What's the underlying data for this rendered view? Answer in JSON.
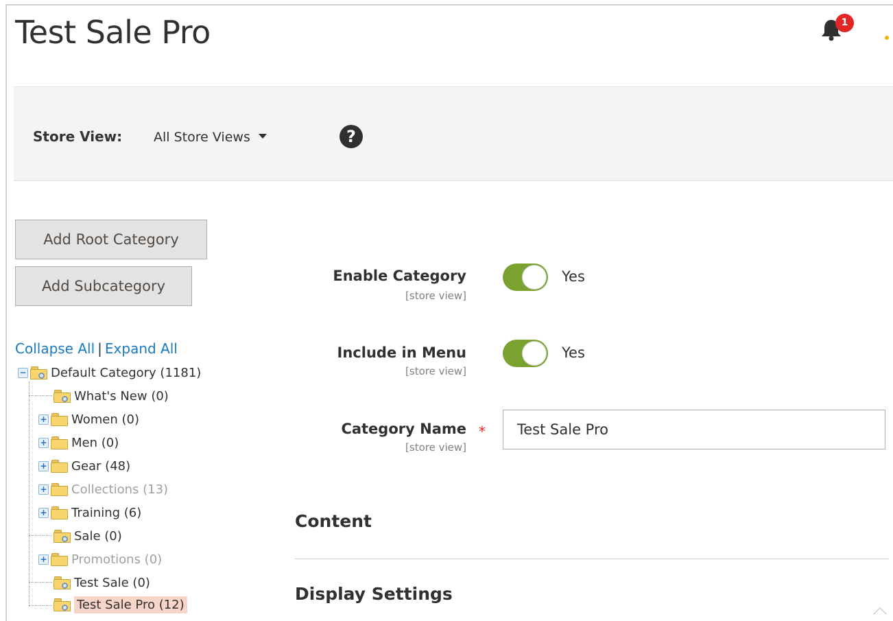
{
  "page": {
    "title": "Test Sale Pro"
  },
  "header": {
    "notifications_count": "1"
  },
  "store_view": {
    "label": "Store View:",
    "selected": "All Store Views",
    "help": "?"
  },
  "buttons": {
    "add_root": "Add Root Category",
    "add_sub": "Add Subcategory"
  },
  "tree_controls": {
    "collapse": "Collapse All",
    "separator": "|",
    "expand": "Expand All"
  },
  "tree": {
    "items": [
      {
        "label": "Default Category (1181)",
        "level": 0,
        "expander": "−",
        "muted": false,
        "selected": false
      },
      {
        "label": "What's New (0)",
        "level": 1,
        "expander": "",
        "muted": false,
        "selected": false
      },
      {
        "label": "Women (0)",
        "level": 1,
        "expander": "+",
        "muted": false,
        "selected": false
      },
      {
        "label": "Men (0)",
        "level": 1,
        "expander": "+",
        "muted": false,
        "selected": false
      },
      {
        "label": "Gear (48)",
        "level": 1,
        "expander": "+",
        "muted": false,
        "selected": false
      },
      {
        "label": "Collections (13)",
        "level": 1,
        "expander": "+",
        "muted": true,
        "selected": false
      },
      {
        "label": "Training (6)",
        "level": 1,
        "expander": "+",
        "muted": false,
        "selected": false
      },
      {
        "label": "Sale (0)",
        "level": 1,
        "expander": "",
        "muted": false,
        "selected": false
      },
      {
        "label": "Promotions (0)",
        "level": 1,
        "expander": "+",
        "muted": true,
        "selected": false
      },
      {
        "label": "Test Sale (0)",
        "level": 1,
        "expander": "",
        "muted": false,
        "selected": false
      },
      {
        "label": "Test Sale Pro (12)",
        "level": 1,
        "expander": "",
        "muted": false,
        "selected": true
      }
    ]
  },
  "form": {
    "enable_category": {
      "label": "Enable Category",
      "scope": "[store view]",
      "value": "Yes",
      "checked": true
    },
    "include_in_menu": {
      "label": "Include in Menu",
      "scope": "[store view]",
      "value": "Yes",
      "checked": true
    },
    "category_name": {
      "label": "Category Name",
      "scope": "[store view]",
      "required": "*",
      "value": "Test Sale Pro"
    }
  },
  "sections": {
    "content": "Content",
    "display_settings": "Display Settings"
  },
  "colors": {
    "toggle_on": "#79a22e",
    "link": "#1979c3",
    "selected_bg": "#f7d5c8",
    "required": "#e22626"
  }
}
